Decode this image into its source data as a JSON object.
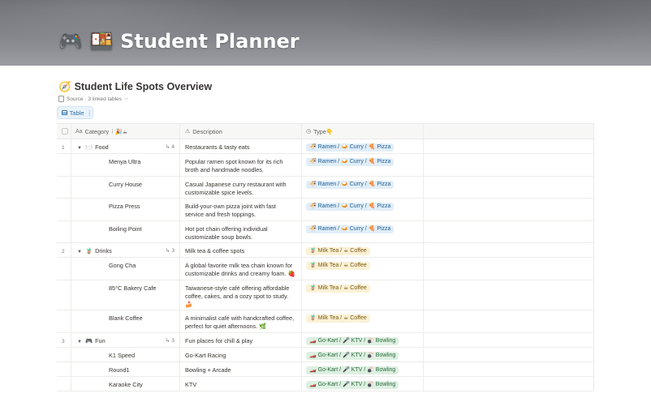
{
  "page": {
    "title_emoji": "🎮 🍱",
    "title": "Student Planner"
  },
  "database": {
    "title_emoji": "🧭",
    "title": "Student Life Spots Overview",
    "source_label": "Source · 3 linked tables",
    "source_chevron": "⌵",
    "view_tab_label": "Table",
    "view_tab_more": "⋮"
  },
  "table": {
    "headers": {
      "category": "Category",
      "category_extra": "⁝ 🎉☕",
      "description": "Description",
      "type": "Type👇"
    },
    "header_icons": {
      "category": "text-icon",
      "description": "alert-triangle-icon",
      "type": "clock-status-icon"
    },
    "groups": [
      {
        "number": "1",
        "emoji": "🍽️",
        "name": "Food",
        "count": "4",
        "description": "Restaurants & tasty eats",
        "type_tag": "🍜 Ramen / 🍛 Curry / 🍕 Pizza",
        "children": [
          {
            "name": "Menya Ultra",
            "description": "Popular ramen spot known for its rich broth and handmade noodles.",
            "type_tag": "🍜 Ramen / 🍛 Curry / 🍕 Pizza"
          },
          {
            "name": "Curry House",
            "description": "Casual Japanese curry restaurant with customizable spice levels.",
            "type_tag": "🍜 Ramen / 🍛 Curry / 🍕 Pizza"
          },
          {
            "name": "Pizza Press",
            "description": "Build-your-own pizza joint with fast service and fresh toppings.",
            "type_tag": "🍜 Ramen / 🍛 Curry / 🍕 Pizza"
          },
          {
            "name": "Boiling Point",
            "description": "Hot pot chain offering individual customizable soup bowls.",
            "type_tag": "🍜 Ramen / 🍛 Curry / 🍕 Pizza"
          }
        ]
      },
      {
        "number": "2",
        "emoji": "🧋",
        "name": "Drinks",
        "count": "3",
        "description": "Milk tea & coffee spots",
        "type_tag": "🧋 Milk Tea / ☕ Coffee",
        "children": [
          {
            "name": "Gong Cha",
            "description": "A global favorite milk tea chain known for customizable drinks and creamy foam. 🍓",
            "type_tag": "🧋 Milk Tea / ☕ Coffee"
          },
          {
            "name": "85°C Bakery Cafe",
            "description": "Taiwanese-style café offering affordable coffee, cakes, and a cozy spot to study. 🍰",
            "type_tag": "🧋 Milk Tea / ☕ Coffee"
          },
          {
            "name": "Blank Coffee",
            "description": "A minimalist café with handcrafted coffee, perfect for quiet afternoons. 🌿",
            "type_tag": "🧋 Milk Tea / ☕ Coffee"
          }
        ]
      },
      {
        "number": "3",
        "emoji": "🎮",
        "name": "Fun",
        "count": "3",
        "description": "Fun places for chill & play",
        "type_tag": "🏎️ Go-Kart / 🎤 KTV / 🎳 Bowling",
        "children": [
          {
            "name": "K1 Speed",
            "description": "Go-Kart Racing",
            "type_tag": "🏎️ Go-Kart / 🎤 KTV / 🎳 Bowling"
          },
          {
            "name": "Round1",
            "description": "Bowling + Arcade",
            "type_tag": "🏎️ Go-Kart / 🎤 KTV / 🎳 Bowling"
          },
          {
            "name": "Karaoke City",
            "description": "KTV",
            "type_tag": "🏎️ Go-Kart / 🎤 KTV / 🎳 Bowling"
          }
        ]
      }
    ]
  },
  "colors": {
    "tag_food_bg": "#e1eef8",
    "tag_drinks_bg": "#fbf1d6",
    "tag_fun_bg": "#def0e2",
    "view_tab_accent": "#2f6fa8"
  }
}
